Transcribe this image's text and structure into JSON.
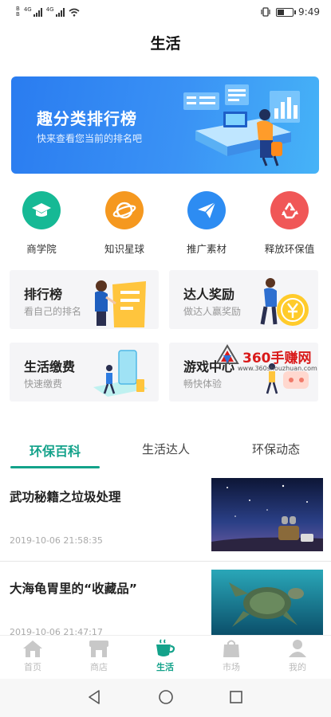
{
  "status_bar": {
    "sim1": "B",
    "sim1b": "B",
    "net1": "4G",
    "net2": "4G",
    "time": "9:49",
    "battery_level": 0.45
  },
  "page": {
    "title": "生活"
  },
  "banner": {
    "title": "趣分类排行榜",
    "subtitle": "快来查看您当前的排名吧"
  },
  "shortcuts": [
    {
      "label": "商学院",
      "icon": "graduation-cap-icon",
      "color": "#13b894"
    },
    {
      "label": "知识星球",
      "icon": "planet-icon",
      "color": "#f59a1f"
    },
    {
      "label": "推广素材",
      "icon": "paper-plane-icon",
      "color": "#2f8cf3"
    },
    {
      "label": "释放环保值",
      "icon": "recycle-icon",
      "color": "#f05a5a"
    }
  ],
  "cards": [
    {
      "title": "排行榜",
      "subtitle": "看自己的排名"
    },
    {
      "title": "达人奖励",
      "subtitle": "做达人赢奖励"
    },
    {
      "title": "生活缴费",
      "subtitle": "快速缴费"
    },
    {
      "title": "游戏中心",
      "subtitle": "畅快体验"
    }
  ],
  "watermark": {
    "brand": "360手赚网",
    "url": "www.360shouzhuan.com"
  },
  "tabs": [
    {
      "label": "环保百科",
      "active": true
    },
    {
      "label": "生活达人",
      "active": false
    },
    {
      "label": "环保动态",
      "active": false
    }
  ],
  "articles": [
    {
      "title": "武功秘籍之垃圾处理",
      "date": "2019-10-06 21:58:35"
    },
    {
      "title": "大海龟胃里的“收藏品”",
      "date": "2019-10-06 21:47:17"
    }
  ],
  "bottom_nav": [
    {
      "label": "首页",
      "icon": "home-icon",
      "active": false
    },
    {
      "label": "商店",
      "icon": "store-icon",
      "active": false
    },
    {
      "label": "生活",
      "icon": "coffee-cup-icon",
      "active": true
    },
    {
      "label": "市场",
      "icon": "shopping-bag-icon",
      "active": false
    },
    {
      "label": "我的",
      "icon": "user-icon",
      "active": false
    }
  ],
  "colors": {
    "accent": "#13a28a",
    "banner": "#2a7cf0"
  }
}
